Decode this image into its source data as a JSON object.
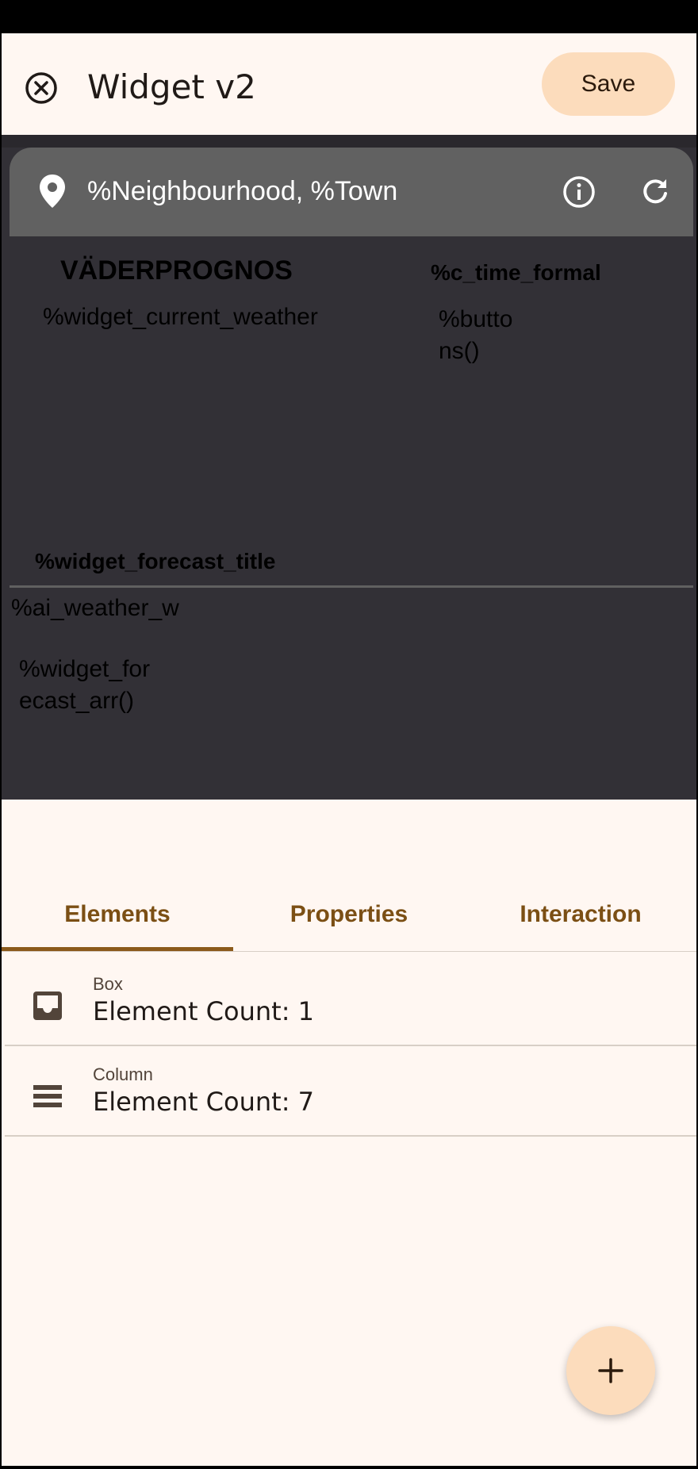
{
  "app_bar": {
    "title": "Widget v2",
    "save_label": "Save"
  },
  "widget_preview": {
    "location": "%Neighbourhood, %Town",
    "title": "VÄDERPROGNOS",
    "time": "%c_time_formal",
    "current_weather": "%widget_current_weather",
    "buttons": "%buttons()",
    "forecast_title": "%widget_forecast_title",
    "ai_weather": "%ai_weather_w",
    "forecast_arr": "%widget_forecast_arr()"
  },
  "tabs": [
    {
      "label": "Elements",
      "selected": true
    },
    {
      "label": "Properties",
      "selected": false
    },
    {
      "label": "Interaction",
      "selected": false
    }
  ],
  "elements": [
    {
      "type": "Box",
      "count_text": "Element Count: 1",
      "icon": "inbox-icon"
    },
    {
      "type": "Column",
      "count_text": "Element Count: 7",
      "icon": "column-icon"
    }
  ],
  "fab": {
    "icon": "plus-icon"
  },
  "colors": {
    "background": "#fff7f2",
    "accent": "#fcdcbc",
    "tab_text": "#7b4f14",
    "preview_bg": "#323036",
    "header_bg": "#616161"
  }
}
